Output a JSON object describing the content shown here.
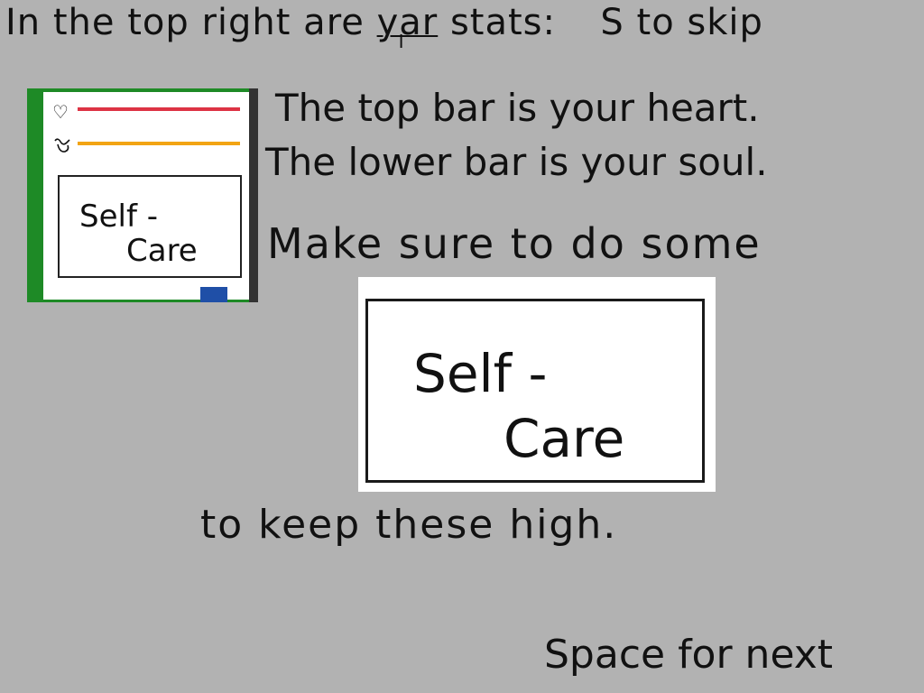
{
  "instructions": {
    "line1_before": "In the top right are ",
    "line1_typo": "yar",
    "line1_after": " stats:",
    "skip_hint": "S to skip",
    "line2": "The top bar is your heart.",
    "line3": "The lower bar is your soul.",
    "line4": "Make sure to do some",
    "line5": "to keep these high.",
    "next_hint": "Space for next"
  },
  "hud": {
    "heart_icon": "heart-icon",
    "soul_icon": "soul-icon",
    "heart_level": 1.0,
    "soul_level": 1.0,
    "heart_color": "#dd3344",
    "soul_color": "#f2a413",
    "card_line1": "Self -",
    "card_line2": "Care"
  },
  "card": {
    "line1": "Self -",
    "line2": "Care"
  },
  "colors": {
    "background": "#b2b2b2",
    "grass": "#1e8a26"
  }
}
